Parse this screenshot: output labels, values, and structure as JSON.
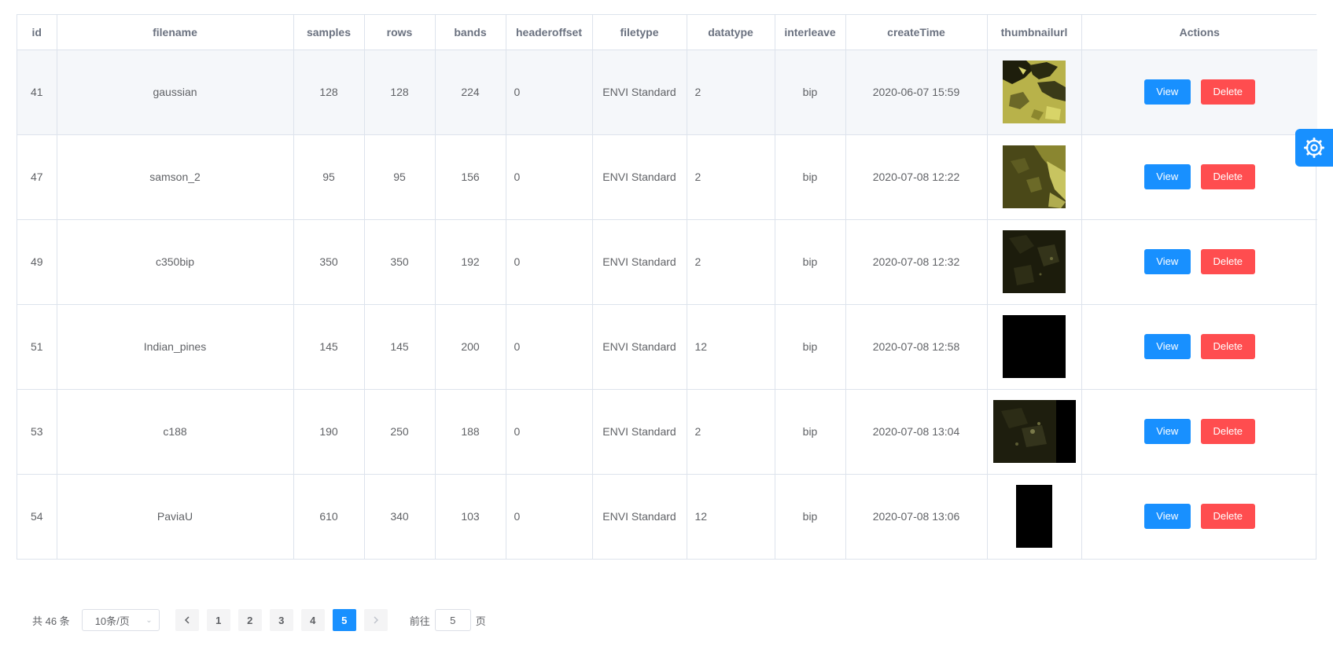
{
  "table": {
    "columns": [
      "id",
      "filename",
      "samples",
      "rows",
      "bands",
      "headeroffset",
      "filetype",
      "datatype",
      "interleave",
      "createTime",
      "thumbnailurl",
      "Actions"
    ],
    "rows": [
      {
        "id": "41",
        "filename": "gaussian",
        "samples": "128",
        "rows": "128",
        "bands": "224",
        "headeroffset": "0",
        "filetype": "ENVI Standard",
        "datatype": "2",
        "interleave": "bip",
        "createTime": "2020-06-07 15:59"
      },
      {
        "id": "47",
        "filename": "samson_2",
        "samples": "95",
        "rows": "95",
        "bands": "156",
        "headeroffset": "0",
        "filetype": "ENVI Standard",
        "datatype": "2",
        "interleave": "bip",
        "createTime": "2020-07-08 12:22"
      },
      {
        "id": "49",
        "filename": "c350bip",
        "samples": "350",
        "rows": "350",
        "bands": "192",
        "headeroffset": "0",
        "filetype": "ENVI Standard",
        "datatype": "2",
        "interleave": "bip",
        "createTime": "2020-07-08 12:32"
      },
      {
        "id": "51",
        "filename": "Indian_pines",
        "samples": "145",
        "rows": "145",
        "bands": "200",
        "headeroffset": "0",
        "filetype": "ENVI Standard",
        "datatype": "12",
        "interleave": "bip",
        "createTime": "2020-07-08 12:58"
      },
      {
        "id": "53",
        "filename": "c188",
        "samples": "190",
        "rows": "250",
        "bands": "188",
        "headeroffset": "0",
        "filetype": "ENVI Standard",
        "datatype": "2",
        "interleave": "bip",
        "createTime": "2020-07-08 13:04"
      },
      {
        "id": "54",
        "filename": "PaviaU",
        "samples": "610",
        "rows": "340",
        "bands": "103",
        "headeroffset": "0",
        "filetype": "ENVI Standard",
        "datatype": "12",
        "interleave": "bip",
        "createTime": "2020-07-08 13:06"
      }
    ],
    "view_label": "View",
    "delete_label": "Delete"
  },
  "pagination": {
    "total": "共 46 条",
    "page_size": "10条/页",
    "pages": [
      "1",
      "2",
      "3",
      "4",
      "5"
    ],
    "current_page": "5",
    "goto_prefix": "前往",
    "goto_value": "5",
    "goto_suffix": "页"
  },
  "colors": {
    "primary": "#1890ff",
    "danger": "#ff4d4f",
    "border": "#dde3ec",
    "header_text": "#6b7280"
  },
  "icons": {
    "settings_tab": "gear-icon",
    "prev": "chevron-left-icon",
    "next": "chevron-right-icon",
    "select": "chevron-down-icon"
  }
}
